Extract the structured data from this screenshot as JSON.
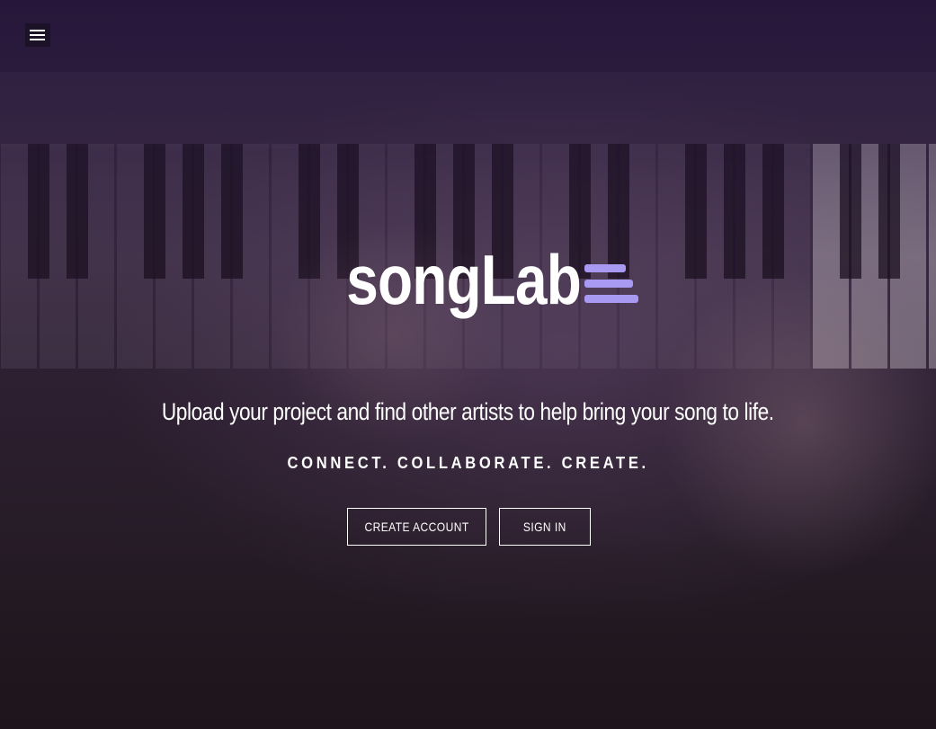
{
  "nav": {
    "menu_icon": "hamburger-menu-icon"
  },
  "brand": {
    "name": "songLab",
    "mark_icon": "stacked-bars-logo-icon",
    "accent_color": "#a89af2"
  },
  "hero": {
    "tagline": "Upload your project and find other artists to help bring your song to life.",
    "motto": "CONNECT. COLLABORATE. CREATE."
  },
  "actions": {
    "create_account_label": "CREATE ACCOUNT",
    "sign_in_label": "SIGN IN"
  },
  "colors": {
    "overlay": "#2a1a3e",
    "text": "#ffffff"
  }
}
